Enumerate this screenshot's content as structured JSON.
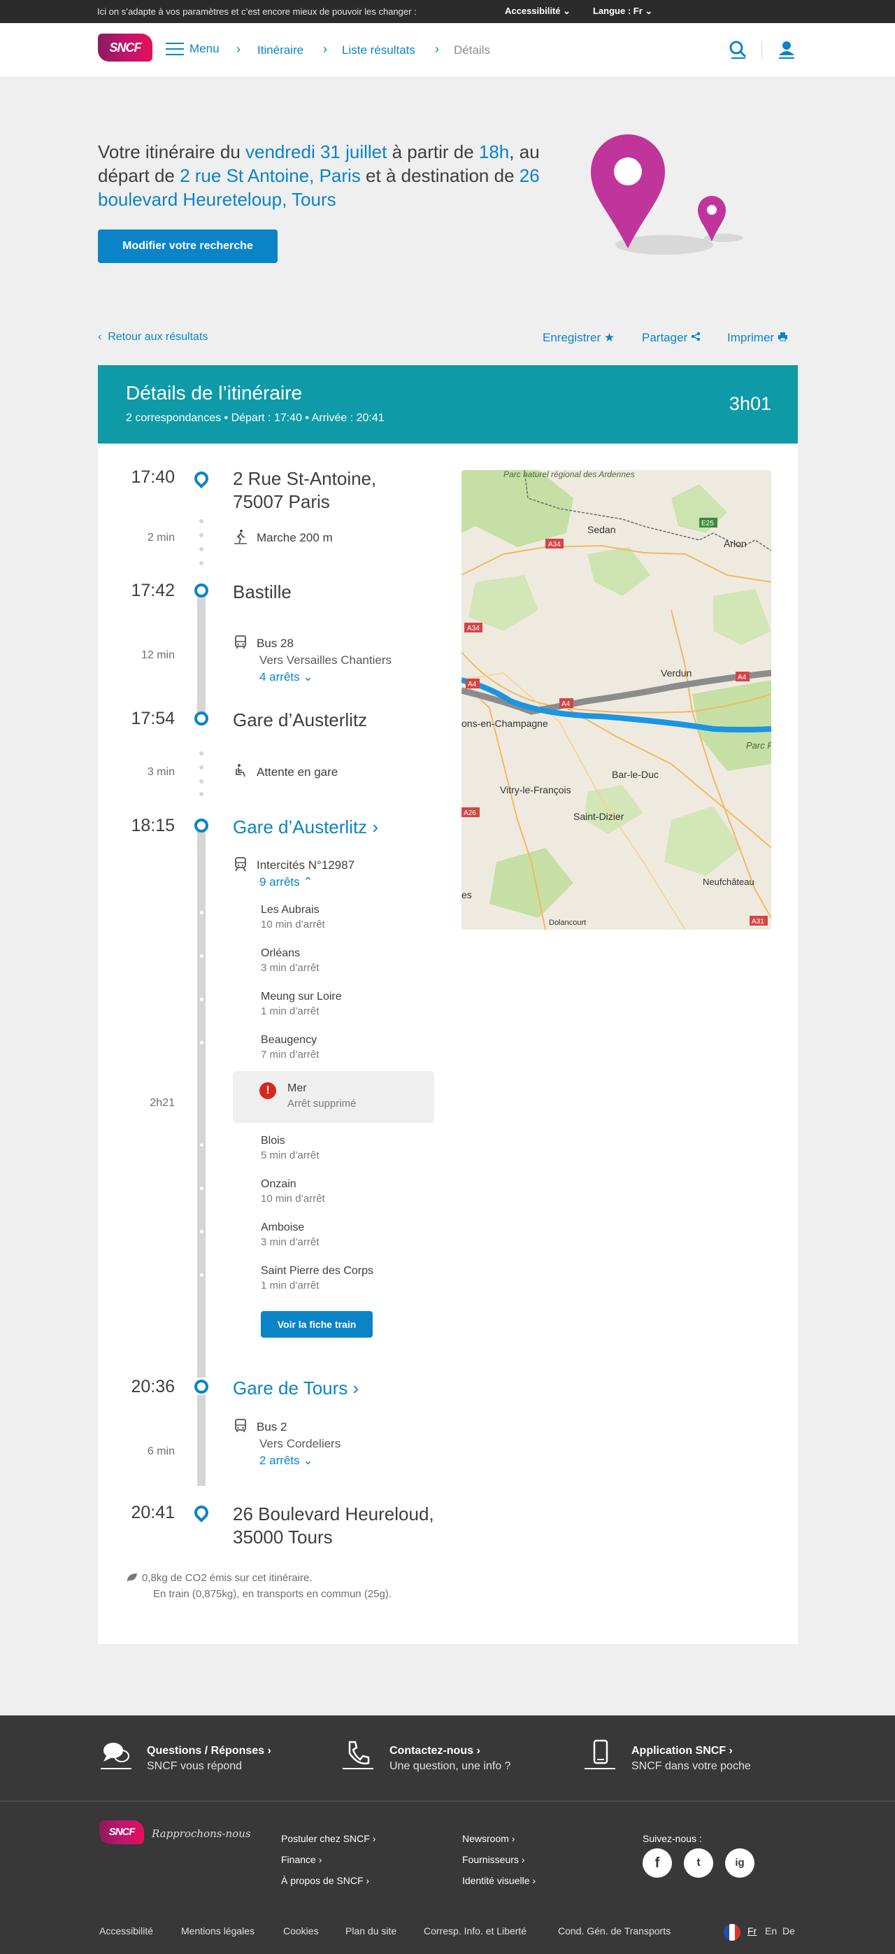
{
  "utility_bar": {
    "message": "Ici on s’adapte à vos paramètres et c’est encore mieux de pouvoir les changer :",
    "accessibility": "Accessibilité",
    "language": "Langue : Fr"
  },
  "header": {
    "logo": "SNCF",
    "menu": "Menu",
    "breadcrumb": [
      "Itinéraire",
      "Liste résultats",
      "Détails"
    ]
  },
  "hero": {
    "p1": "Votre itinéraire du ",
    "date": "vendredi 31 juillet",
    "p2": " à partir de ",
    "hour": "18h",
    "p3": ", au départ de ",
    "from": "2 rue St Antoine, Paris",
    "p4": " et à destination de ",
    "to": "26 boulevard Heureteloup, Tours",
    "modify_button": "Modifier votre recherche"
  },
  "toolbar": {
    "back": "Retour aux résultats",
    "save": "Enregistrer",
    "share": "Partager",
    "print": "Imprimer"
  },
  "summary": {
    "title": "Détails de l’itinéraire",
    "subtitle": "2 correspondances  •  Départ : 17:40  •  Arrivée : 20:41",
    "duration": "3h01"
  },
  "timeline": {
    "t1": "17:40",
    "s1a": "2 Rue St-Antoine,",
    "s1b": "75007 Paris",
    "d1": "2 min",
    "walk": "Marche",
    "walk_dist": "200 m",
    "t2": "17:42",
    "s2": "Bastille",
    "d2": "12 min",
    "bus1": "Bus 28",
    "bus1_dir": "Vers Versailles Chantiers",
    "bus1_stops": "4 arrêts",
    "t3": "17:54",
    "s3": "Gare d’Austerlitz",
    "d3": "3 min",
    "wait": "Attente en gare",
    "t4": "18:15",
    "s4": "Gare d’Austerlitz",
    "d4": "2h21",
    "train": "Intercités N°12987",
    "train_stops": "9 arrêts",
    "t5": "20:36",
    "s5": "Gare de Tours",
    "d5": "6 min",
    "bus2": "Bus 2",
    "bus2_dir": "Vers Cordeliers",
    "bus2_stops": "2 arrêts",
    "t6": "20:41",
    "s6a": "26 Boulevard Heureloud,",
    "s6b": "35000 Tours"
  },
  "train_stops": [
    {
      "name": "Les Aubrais",
      "wait": "10 min d’arrêt"
    },
    {
      "name": "Orléans",
      "wait": "3 min d’arrêt"
    },
    {
      "name": "Meung sur Loire",
      "wait": "1 min d’arrêt"
    },
    {
      "name": "Beaugency",
      "wait": "7 min d’arrêt"
    },
    {
      "name": "Mer",
      "wait": "Arrêt supprimé"
    },
    {
      "name": "Blois",
      "wait": "5 min d’arrêt"
    },
    {
      "name": "Onzain",
      "wait": "10 min d’arrêt"
    },
    {
      "name": "Amboise",
      "wait": "3 min d’arrêt"
    },
    {
      "name": "Saint Pierre des Corps",
      "wait": "1 min d’arrêt"
    }
  ],
  "train_sheet_button": "Voir la fiche train",
  "map_labels": {
    "park": "Parc naturel régional des Ardennes",
    "sedan": "Sedan",
    "arlon": "Arlon",
    "verdun": "Verdun",
    "chalons": "ons-en-Champagne",
    "vitry": "Vitry-le-François",
    "barleduc": "Bar-le-Duc",
    "stdizier": "Saint-Dizier",
    "neufchateau": "Neufchâteau",
    "dolancourt": "Dolancourt",
    "es": "es",
    "parc_r": "Parc Ré de L",
    "a34": "A34",
    "a4": "A4",
    "a26": "A26",
    "a31": "A31",
    "e25": "E25"
  },
  "co2": {
    "line1": "0,8kg de CO2 émis sur cet itinéraire.",
    "line2": "En train  (0,875kg), en transports en commun (25g)."
  },
  "footer": {
    "faq_title": "Questions / Réponses",
    "faq_sub": "SNCF vous répond",
    "contact_title": "Contactez-nous",
    "contact_sub": "Une question, une info ?",
    "app_title": "Application SNCF",
    "app_sub": "SNCF dans votre poche",
    "tagline": "Rapprochons-nous",
    "col1": [
      "Postuler chez SNCF",
      "Finance",
      "À propos de SNCF"
    ],
    "col2": [
      "Newsroom",
      "Fournisseurs",
      "Identité visuelle"
    ],
    "follow": "Suivez-nous :",
    "social": [
      "f",
      "t",
      "ig"
    ],
    "bottom": [
      "Accessibilité",
      "Mentions légales",
      "Cookies",
      "Plan du site",
      "Corresp. Info. et Liberté",
      "Cond. Gén. de Transports"
    ],
    "langs": [
      "Fr",
      "En",
      "De"
    ]
  },
  "colors": {
    "accent": "#0a84c7",
    "teal": "#0f9aa8",
    "footer": "#383838",
    "error": "#d9261c",
    "pin": "#c0359c"
  }
}
